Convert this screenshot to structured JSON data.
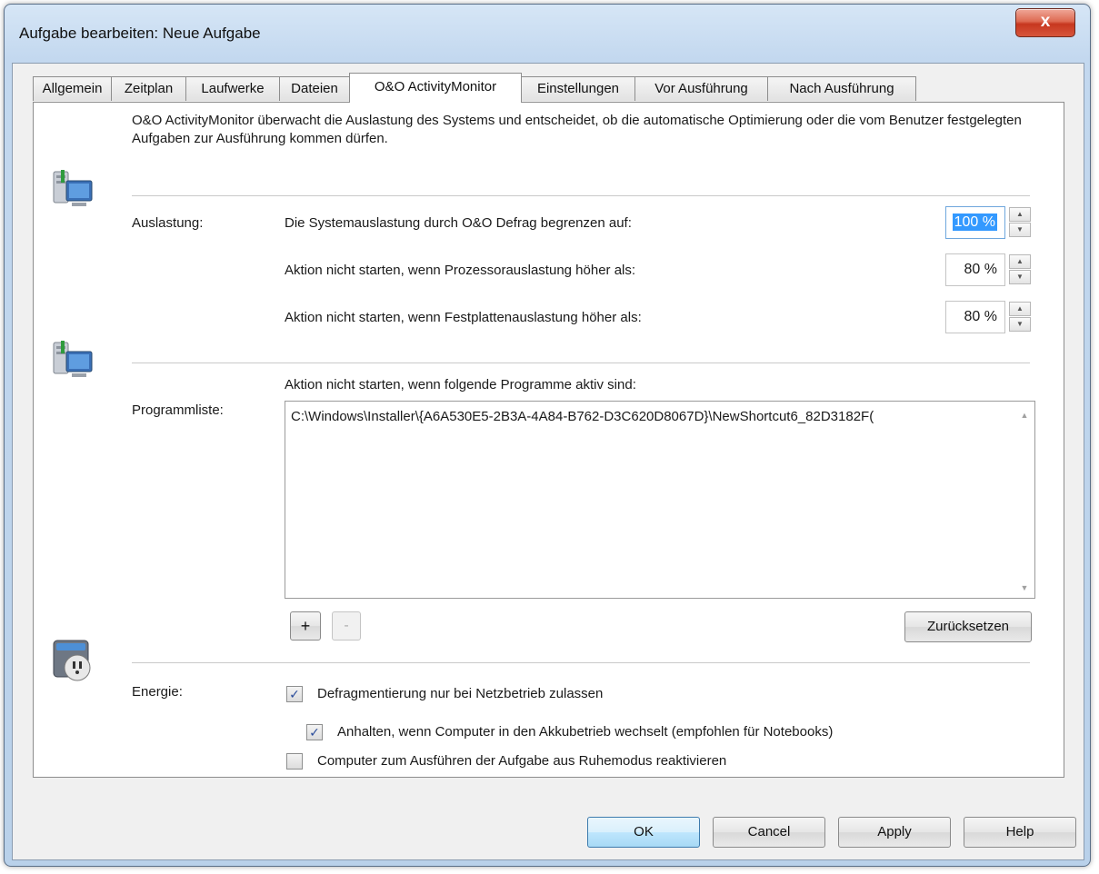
{
  "window": {
    "title": "Aufgabe bearbeiten: Neue Aufgabe",
    "close_label": "x"
  },
  "tabs": [
    {
      "label": "Allgemein"
    },
    {
      "label": "Zeitplan"
    },
    {
      "label": "Laufwerke"
    },
    {
      "label": "Dateien"
    },
    {
      "label": "O&O ActivityMonitor",
      "active": true
    },
    {
      "label": "Einstellungen"
    },
    {
      "label": "Vor Ausführung"
    },
    {
      "label": "Nach Ausführung"
    }
  ],
  "intro_text": "O&O ActivityMonitor überwacht die Auslastung des Systems und entscheidet, ob die automatische Optimierung oder die vom Benutzer festgelegten Aufgaben zur Ausführung kommen dürfen.",
  "load": {
    "label": "Auslastung:",
    "rows": [
      {
        "text": "Die Systemauslastung durch O&O Defrag begrenzen auf:",
        "value": "100 %"
      },
      {
        "text": "Aktion nicht starten, wenn Prozessorauslastung höher als:",
        "value": "80 %"
      },
      {
        "text": "Aktion nicht starten, wenn Festplattenauslastung höher als:",
        "value": "80 %"
      }
    ]
  },
  "programs": {
    "label": "Programmliste:",
    "heading": "Aktion nicht starten, wenn folgende Programme aktiv sind:",
    "items": [
      "C:\\Windows\\Installer\\{A6A530E5-2B3A-4A84-B762-D3C620D8067D}\\NewShortcut6_82D3182F("
    ],
    "add_label": "+",
    "remove_label": "-",
    "reset_label": "Zurücksetzen"
  },
  "energy": {
    "label": "Energie:",
    "options": [
      {
        "text": "Defragmentierung nur bei Netzbetrieb zulassen",
        "checked": true
      },
      {
        "text": "Anhalten, wenn Computer in den Akkubetrieb wechselt (empfohlen für Notebooks)",
        "checked": true
      },
      {
        "text": "Computer zum Ausführen der Aufgabe aus Ruhemodus reaktivieren",
        "checked": false
      }
    ],
    "check_mark": "✓"
  },
  "footer": {
    "ok_label": "OK",
    "cancel_label": "Cancel",
    "apply_label": "Apply",
    "help_label": "Help"
  },
  "icons": {
    "monitor_1": "monitor-activity-icon",
    "monitor_2": "monitor-activity-icon",
    "power": "power-plug-icon"
  }
}
